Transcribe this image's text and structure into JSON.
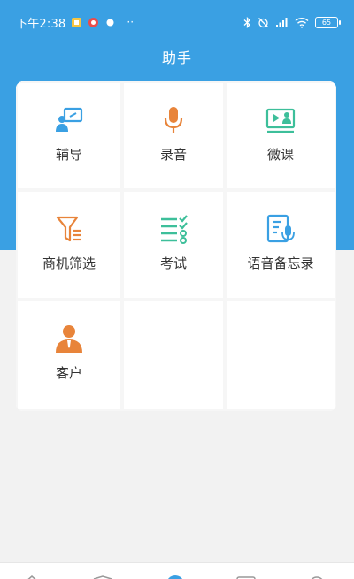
{
  "status_bar": {
    "time": "下午2:38",
    "battery": "65"
  },
  "header": {
    "title": "助手"
  },
  "grid": {
    "items": [
      {
        "label": "辅导",
        "icon": "tutoring-icon",
        "color": "#3aa0e3"
      },
      {
        "label": "录音",
        "icon": "microphone-icon",
        "color": "#e8843a"
      },
      {
        "label": "微课",
        "icon": "micro-course-icon",
        "color": "#3dbf9a"
      },
      {
        "label": "商机筛选",
        "icon": "funnel-filter-icon",
        "color": "#e8843a"
      },
      {
        "label": "考试",
        "icon": "checklist-exam-icon",
        "color": "#3dbf9a"
      },
      {
        "label": "语音备忘录",
        "icon": "voice-memo-icon",
        "color": "#3aa0e3"
      },
      {
        "label": "客户",
        "icon": "customer-person-icon",
        "color": "#e8843a"
      }
    ]
  },
  "colors": {
    "header_blue": "#3aa0e3",
    "orange": "#e8843a",
    "green": "#3dbf9a"
  }
}
